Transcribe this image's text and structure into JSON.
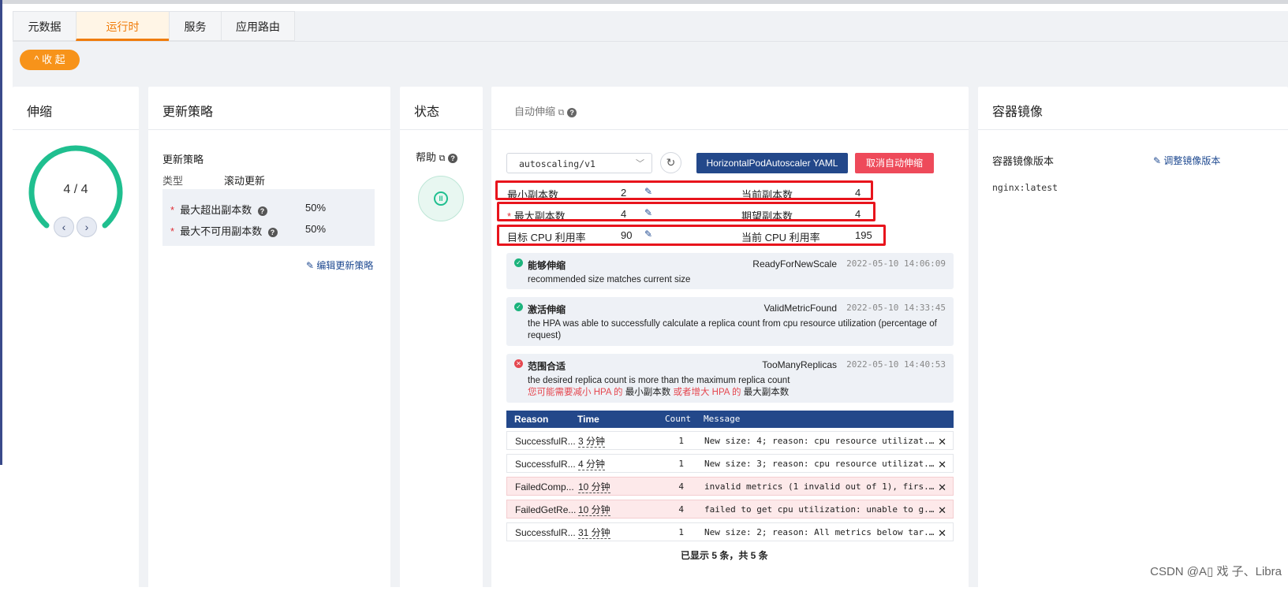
{
  "tabs": [
    {
      "label": "元数据"
    },
    {
      "label": "运行时"
    },
    {
      "label": "服务"
    },
    {
      "label": "应用路由"
    }
  ],
  "collapse_label": "^ 收 起",
  "scale": {
    "title": "伸缩",
    "replicas_text": "4 / 4",
    "fill_fraction": 1.0,
    "prev_icon": "chevron-left-icon",
    "next_icon": "chevron-right-icon"
  },
  "update_strategy": {
    "card_title": "更新策略",
    "section_title": "更新策略",
    "type_label": "类型",
    "type_value": "滚动更新",
    "max_surge_label": "最大超出副本数",
    "max_surge_value": "50%",
    "max_unavailable_label": "最大不可用副本数",
    "max_unavailable_value": "50%",
    "edit_link": "编辑更新策略",
    "required_mark": "*"
  },
  "status": {
    "title": "状态",
    "help_label": "帮助",
    "pause_icon": "pause-icon"
  },
  "autoscale": {
    "title": "自动伸缩",
    "api_version": "autoscaling/v1",
    "yaml_button": "HorizontalPodAutoscaler YAML",
    "cancel_button": "取消自动伸缩",
    "min_label": "最小副本数",
    "min_value": "2",
    "current_label": "当前副本数",
    "current_value": "4",
    "max_label": "最大副本数",
    "max_value": "4",
    "desired_label": "期望副本数",
    "desired_value": "4",
    "target_cpu_label": "目标 CPU 利用率",
    "target_cpu_value": "90",
    "current_cpu_label": "当前 CPU 利用率",
    "current_cpu_value": "195"
  },
  "conditions": [
    {
      "title": "能够伸缩",
      "reason": "ReadyForNewScale",
      "time": "2022-05-10 14:06:09",
      "message": "recommended size matches current size",
      "status": "ok"
    },
    {
      "title": "激活伸缩",
      "reason": "ValidMetricFound",
      "time": "2022-05-10 14:33:45",
      "message": "the HPA was able to successfully calculate a replica count from cpu resource utilization (percentage of request)",
      "status": "ok"
    },
    {
      "title": "范围合适",
      "reason": "TooManyReplicas",
      "time": "2022-05-10 14:40:53",
      "message": "the desired replica count is more than the maximum replica count",
      "hint_a": "您可能需要减小 HPA 的",
      "hint_b": "最小副本数",
      "hint_c": "或者增大 HPA 的",
      "hint_d": "最大副本数",
      "status": "error"
    }
  ],
  "events": {
    "headers": {
      "reason": "Reason",
      "time": "Time",
      "count": "Count",
      "message": "Message"
    },
    "rows": [
      {
        "reason": "SuccessfulR...",
        "time": "3 分钟",
        "count": "1",
        "message": "New size: 4; reason: cpu resource utilizat...",
        "type": "normal"
      },
      {
        "reason": "SuccessfulR...",
        "time": "4 分钟",
        "count": "1",
        "message": "New size: 3; reason: cpu resource utilizat...",
        "type": "normal"
      },
      {
        "reason": "FailedComp...",
        "time": "10 分钟",
        "count": "4",
        "message": "invalid metrics (1 invalid out of 1), firs...",
        "type": "error"
      },
      {
        "reason": "FailedGetRe...",
        "time": "10 分钟",
        "count": "4",
        "message": "failed to get cpu utilization: unable to g...",
        "type": "error"
      },
      {
        "reason": "SuccessfulR...",
        "time": "31 分钟",
        "count": "1",
        "message": "New size: 2; reason: All metrics below tar...",
        "type": "normal"
      }
    ],
    "footer": "已显示 5 条，共 5 条",
    "close_glyph": "✕"
  },
  "image": {
    "title": "容器镜像",
    "version_label": "容器镜像版本",
    "adjust_link": "调整镜像版本",
    "value": "nginx:latest"
  },
  "watermark": "CSDN @A▯ 戏 子、Libra",
  "colors": {
    "accent": "#f7931a",
    "primary": "#23488a",
    "danger": "#ee4a5a",
    "success": "#1bb37c",
    "highlight": "#e8141c"
  }
}
